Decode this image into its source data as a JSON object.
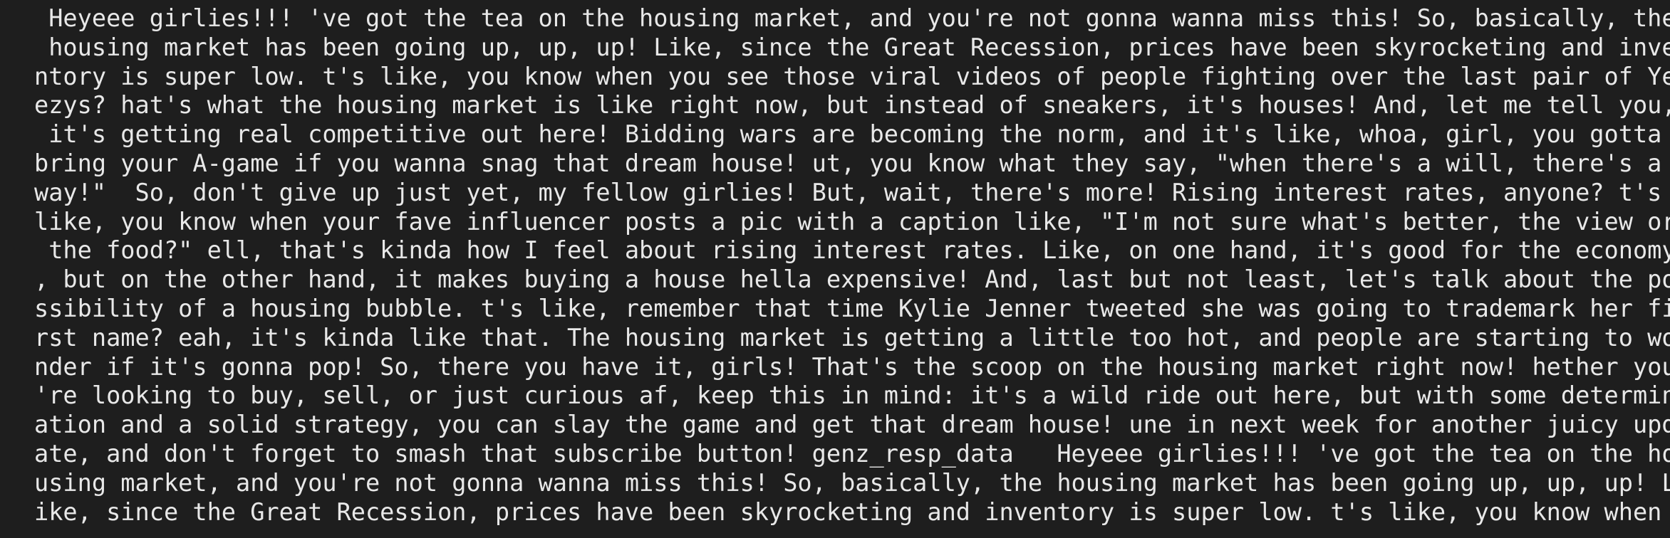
{
  "terminal": {
    "lines": [
      " Heyeee girlies!!! 've got the tea on the housing market, and you're not gonna wanna miss this! So, basically, the",
      " housing market has been going up, up, up! Like, since the Great Recession, prices have been skyrocketing and inve",
      "ntory is super low. t's like, you know when you see those viral videos of people fighting over the last pair of Ye",
      "ezys? hat's what the housing market is like right now, but instead of sneakers, it's houses! And, let me tell you,",
      " it's getting real competitive out here! Bidding wars are becoming the norm, and it's like, whoa, girl, you gotta",
      "bring your A-game if you wanna snag that dream house! ut, you know what they say, \"when there's a will, there's a",
      "way!\"  So, don't give up just yet, my fellow girlies! But, wait, there's more! Rising interest rates, anyone? t's",
      "like, you know when your fave influencer posts a pic with a caption like, \"I'm not sure what's better, the view or",
      " the food?\" ell, that's kinda how I feel about rising interest rates. Like, on one hand, it's good for the economy",
      ", but on the other hand, it makes buying a house hella expensive! And, last but not least, let's talk about the po",
      "ssibility of a housing bubble. t's like, remember that time Kylie Jenner tweeted she was going to trademark her fi",
      "rst name? eah, it's kinda like that. The housing market is getting a little too hot, and people are starting to wo",
      "nder if it's gonna pop! So, there you have it, girls! That's the scoop on the housing market right now! hether you",
      "'re looking to buy, sell, or just curious af, keep this in mind: it's a wild ride out here, but with some determin",
      "ation and a solid strategy, you can slay the game and get that dream house! une in next week for another juicy upd",
      "ate, and don't forget to smash that subscribe button! genz_resp_data   Heyeee girlies!!! 've got the tea on the ho",
      "using market, and you're not gonna wanna miss this! So, basically, the housing market has been going up, up, up! L",
      "ike, since the Great Recession, prices have been skyrocketing and inventory is super low. t's like, you know when"
    ]
  }
}
